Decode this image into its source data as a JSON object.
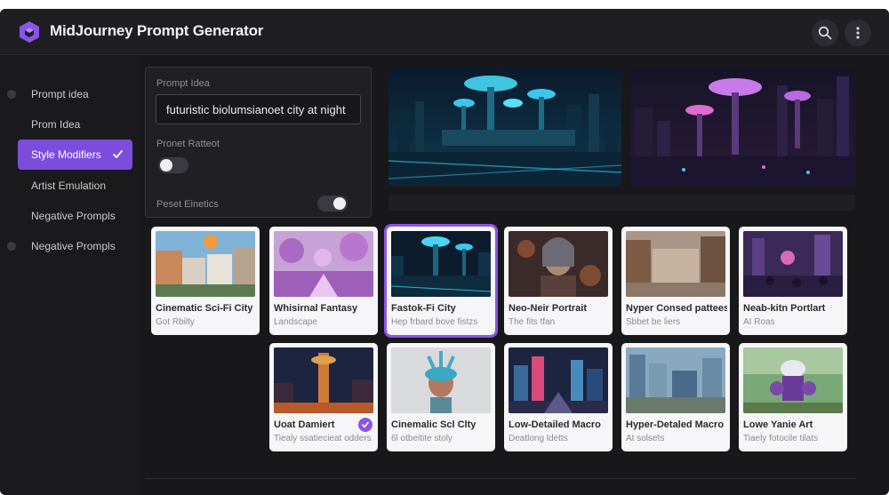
{
  "app": {
    "title": "MidJourney Prompt Generator",
    "accent_color": "#7c4ddb",
    "icons": {
      "logo": "cube-logo-icon",
      "search": "search-icon",
      "menu": "more-vertical-icon"
    }
  },
  "sidebar": {
    "items": [
      {
        "label": "Prompt idea",
        "active": false
      },
      {
        "label": "Prom Idea",
        "active": false
      },
      {
        "label": "Style Modifiers",
        "active": true
      },
      {
        "label": "Artist Emulation",
        "active": false
      },
      {
        "label": "Negative Prompls",
        "active": false
      },
      {
        "label": "Negative Prompls",
        "active": false
      }
    ]
  },
  "panel": {
    "prompt_label": "Prompt Idea",
    "prompt_value": "futuristic biolumsianoet city at night",
    "ratio_label": "Pronet Ratteot",
    "ratio_toggle_on": false,
    "preset_label": "Peset Einetics",
    "preset_toggle_on": true
  },
  "cards": [
    {
      "title": "Cinematic Sci-Fi City",
      "subtitle": "Got Rbilty",
      "selected": false,
      "checked": false,
      "scene": "street-day"
    },
    {
      "title": "Whisirnal Fantasy",
      "subtitle": "Landscape",
      "selected": false,
      "checked": false,
      "scene": "fantasy-pink"
    },
    {
      "title": "Fastok-Fi City",
      "subtitle": "Hep frbard bove fistzs",
      "selected": true,
      "checked": false,
      "scene": "neon-city"
    },
    {
      "title": "Neo-Neir Portrait",
      "subtitle": "The fits tfan",
      "selected": false,
      "checked": false,
      "scene": "portrait"
    },
    {
      "title": "Nyper Consed pattees",
      "subtitle": "Sbbet be liers",
      "selected": false,
      "checked": false,
      "scene": "street-warm"
    },
    {
      "title": "Neab-kitn Portlart",
      "subtitle": "AI Roas",
      "selected": false,
      "checked": false,
      "scene": "purple-crowd"
    },
    {
      "title": "Uoat Damiert",
      "subtitle": "Tiealy ssatiecieat odders",
      "selected": false,
      "checked": true,
      "scene": "tower-night"
    },
    {
      "title": "Cinemalic Scl Clty",
      "subtitle": "6l otbeitite stoly",
      "selected": false,
      "checked": false,
      "scene": "feather-head"
    },
    {
      "title": "Low-Detailed Macro",
      "subtitle": "Deatlong ldetts",
      "selected": false,
      "checked": false,
      "scene": "low-poly-city"
    },
    {
      "title": "Hyper-Detaled Macro",
      "subtitle": "At solsets",
      "selected": false,
      "checked": false,
      "scene": "hyper-city"
    },
    {
      "title": "Lowe Yanie Art",
      "subtitle": "Tiaely fotocile tilats",
      "selected": false,
      "checked": false,
      "scene": "robot"
    }
  ]
}
